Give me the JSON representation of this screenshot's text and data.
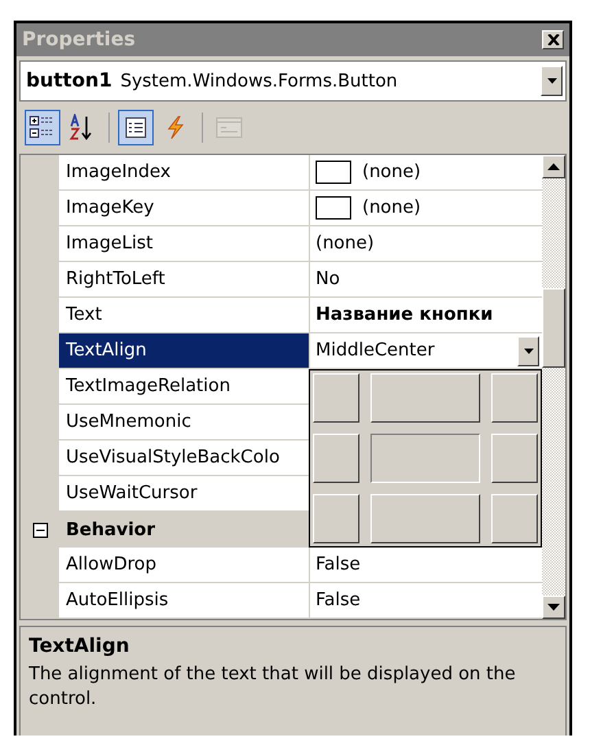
{
  "window": {
    "title": "Properties"
  },
  "object_selector": {
    "name": "button1",
    "type": "System.Windows.Forms.Button"
  },
  "toolbar": [
    {
      "kind": "categorized",
      "selected": true,
      "disabled": false
    },
    {
      "kind": "alphabetical",
      "selected": false,
      "disabled": false
    },
    {
      "kind": "separator"
    },
    {
      "kind": "properties",
      "selected": true,
      "disabled": false
    },
    {
      "kind": "events",
      "selected": false,
      "disabled": false
    },
    {
      "kind": "separator"
    },
    {
      "kind": "property_pages",
      "selected": false,
      "disabled": true
    }
  ],
  "grid": {
    "rows": [
      {
        "kind": "image_property",
        "name": "ImageIndex",
        "value": "(none)",
        "bold": false,
        "selected": false
      },
      {
        "kind": "image_property",
        "name": "ImageKey",
        "value": "(none)",
        "bold": false,
        "selected": false
      },
      {
        "kind": "property",
        "name": "ImageList",
        "value": "(none)",
        "bold": false,
        "selected": false
      },
      {
        "kind": "property",
        "name": "RightToLeft",
        "value": "No",
        "bold": false,
        "selected": false
      },
      {
        "kind": "property",
        "name": "Text",
        "value": "Название кнопки",
        "bold": true,
        "selected": false
      },
      {
        "kind": "property",
        "name": "TextAlign",
        "value": "MiddleCenter",
        "bold": false,
        "selected": true
      },
      {
        "kind": "property",
        "name": "TextImageRelation",
        "selected": false
      },
      {
        "kind": "property",
        "name": "UseMnemonic",
        "selected": false
      },
      {
        "kind": "property",
        "name": "UseVisualStyleBackColo",
        "selected": false
      },
      {
        "kind": "property",
        "name": "UseWaitCursor",
        "selected": false
      },
      {
        "kind": "category",
        "name": "Behavior",
        "expanded": true,
        "selected": false
      },
      {
        "kind": "property",
        "name": "AllowDrop",
        "value": "False",
        "bold": false,
        "selected": false
      },
      {
        "kind": "property",
        "name": "AutoEllipsis",
        "value": "False",
        "bold": false,
        "selected": false
      }
    ],
    "align_picker": {
      "open": true,
      "cells": [
        {
          "selected": false
        },
        {
          "selected": false
        },
        {
          "selected": false
        },
        {
          "selected": false
        },
        {
          "selected": true
        },
        {
          "selected": false
        },
        {
          "selected": false
        },
        {
          "selected": false
        },
        {
          "selected": false
        }
      ]
    }
  },
  "description": {
    "title": "TextAlign",
    "text": "The alignment of the text that will be displayed on the control."
  }
}
